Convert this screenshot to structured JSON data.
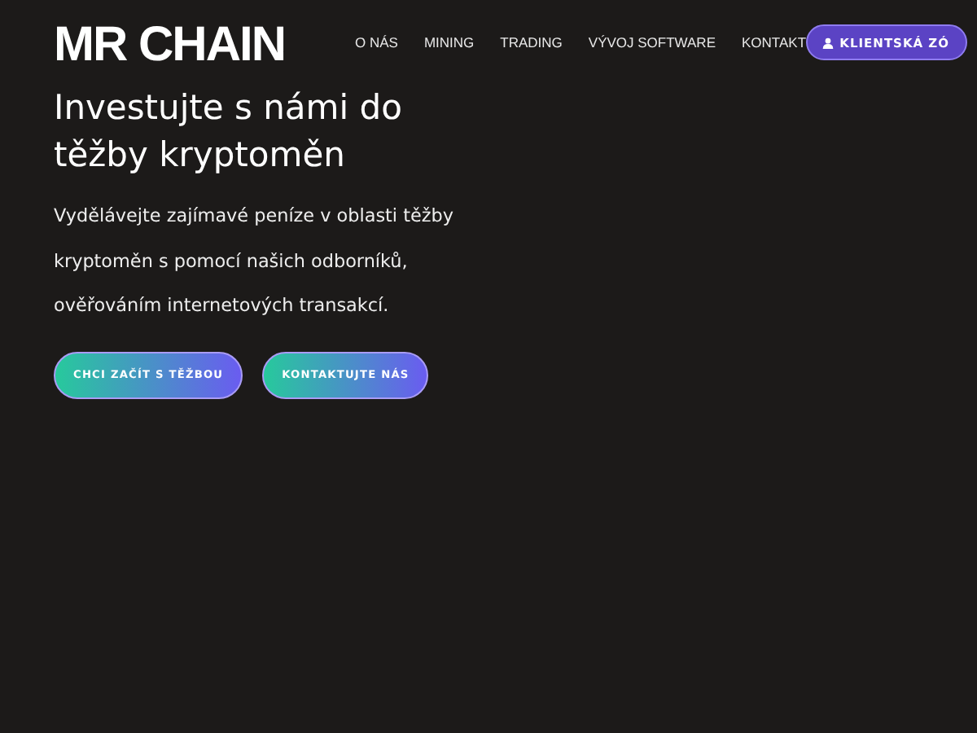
{
  "logo": {
    "text": "MR CHAIN"
  },
  "nav": {
    "items": [
      "O NÁS",
      "MINING",
      "TRADING",
      "VÝVOJ SOFTWARE",
      "KONTAKT"
    ],
    "login_button": "KLIENTSKÁ ZÓ"
  },
  "hero": {
    "title": "Investujte s námi do těžby kryptoměn",
    "text": "Vydělávejte zajímavé peníze v oblasti těžby kryptoměn s pomocí našich odborníků, ověřováním internetových transakcí.",
    "buttons": [
      "CHCI ZAČÍT S TĚŽBOU",
      "KONTAKTUJTE NÁS"
    ]
  }
}
